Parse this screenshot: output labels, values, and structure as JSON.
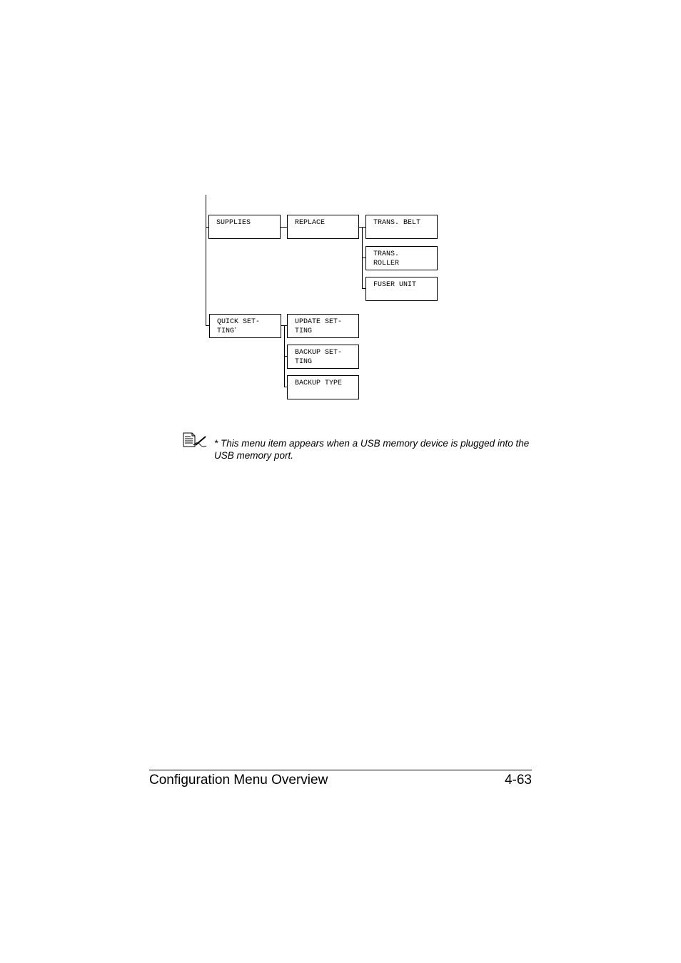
{
  "menu_tree": {
    "items": [
      {
        "label": "SUPPLIES",
        "children": [
          {
            "label": "REPLACE",
            "children": [
              {
                "label": "TRANS. BELT"
              },
              {
                "label": "TRANS.\nROLLER"
              },
              {
                "label": "FUSER UNIT"
              }
            ]
          }
        ]
      },
      {
        "label": "QUICK SET-\nTING",
        "footnote_marker": "*",
        "children": [
          {
            "label": "UPDATE SET-\nTING"
          },
          {
            "label": "BACKUP SET-\nTING"
          },
          {
            "label": "BACKUP TYPE"
          }
        ]
      }
    ]
  },
  "note": {
    "icon": "note-pencil-icon",
    "text": "* This menu item appears when a USB memory device is plugged into the USB memory port."
  },
  "footer": {
    "title": "Configuration Menu Overview",
    "page_number": "4-63"
  }
}
